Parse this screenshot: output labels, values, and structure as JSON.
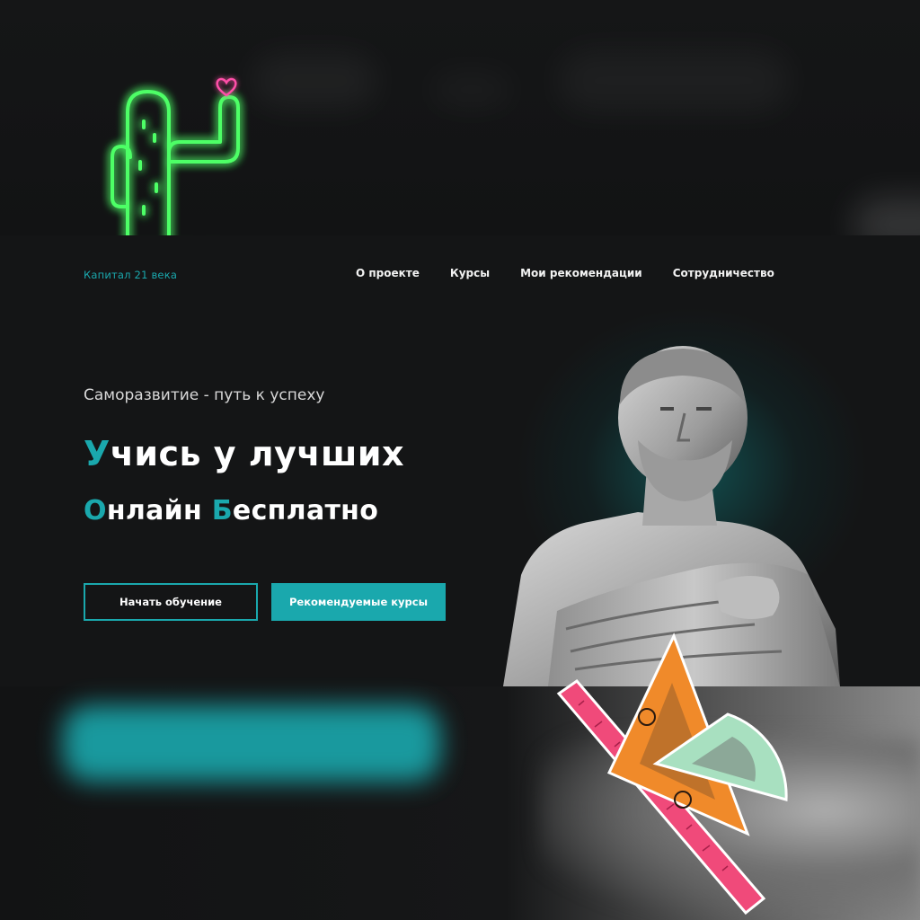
{
  "brand": {
    "name": "Капитал 21 века",
    "logo_icon": "neon-cactus-with-heart-icon"
  },
  "nav": {
    "items": [
      {
        "label": "О проекте"
      },
      {
        "label": "Курсы"
      },
      {
        "label": "Мои рекомендации"
      },
      {
        "label": "Сотрудничество"
      }
    ]
  },
  "hero": {
    "tagline": "Саморазвитие - путь к успеху",
    "headline": {
      "first_letter": "У",
      "rest": "чись у лучших"
    },
    "subheadline": {
      "word1_first": "О",
      "word1_rest": "нлайн ",
      "word2_first": "Б",
      "word2_rest": "есплатно"
    },
    "buttons": {
      "start_label": "Начать обучение",
      "courses_label": "Рекомендуемые курсы"
    }
  },
  "colors": {
    "accent": "#1aa8ad",
    "background": "#141516",
    "neon_green": "#3cff5a",
    "neon_pink": "#ff4fa8"
  },
  "decor": {
    "statue": "greek-statue-image",
    "stickers": "ruler-triangle-protractor-stickers"
  }
}
